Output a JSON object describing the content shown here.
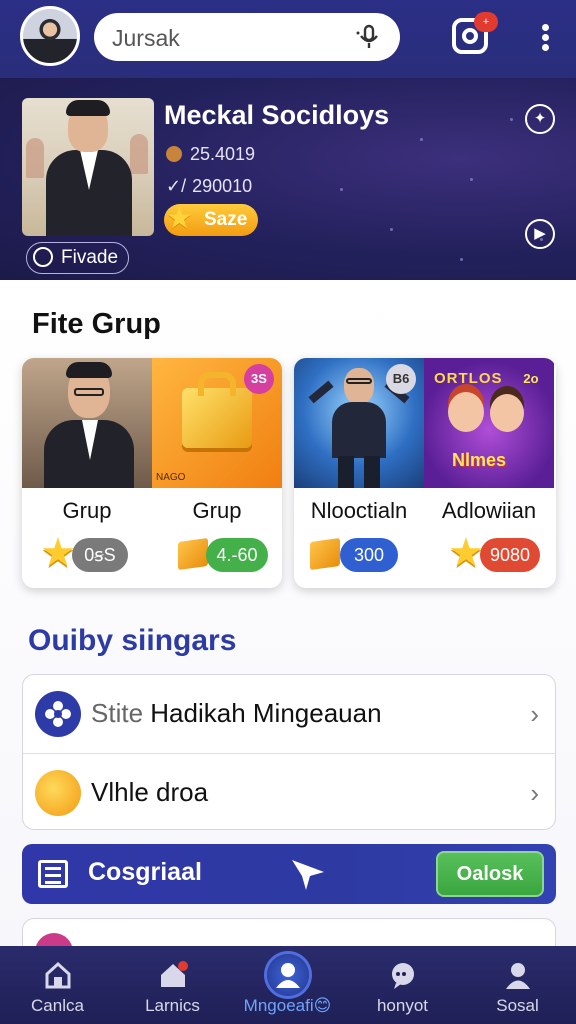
{
  "topbar": {
    "search_value": "Jursak",
    "notification_badge": "+"
  },
  "profile": {
    "name": "Meckal Socidloys",
    "stat1": "25.4019",
    "stat2": "290010",
    "stat2_prefix": "✓/",
    "badge_label": "Saze",
    "chip_label": "Fivade"
  },
  "section1": {
    "title": "Fite Grup",
    "cards": [
      {
        "tiles": [
          {
            "label": "Grup",
            "value": "0ꞩS",
            "pill_color": "#7a7a7a",
            "icon": "star-icon"
          },
          {
            "label": "Grup",
            "value": "4.-60",
            "pill_color": "#44b04a",
            "icon": "box-icon",
            "badge": "3S"
          }
        ],
        "tile_badge_text": "NAGO"
      },
      {
        "tiles": [
          {
            "label": "Nlooctialn",
            "value": "300",
            "pill_color": "#2f5fd0",
            "icon": "box-icon",
            "badge": "B6"
          },
          {
            "label": "Adlowiian",
            "value": "9080",
            "pill_color": "#e04a32",
            "icon": "star-icon",
            "badge": "2o"
          }
        ],
        "poster_title": "ORTLOS",
        "poster_sub": "Nlmes"
      }
    ]
  },
  "section2": {
    "title": "Ouiby siingars",
    "rows": [
      {
        "muted": "Stite",
        "label": "Hadikah Mingeauan"
      },
      {
        "muted": "",
        "label": "Vlhle droa"
      }
    ]
  },
  "banner": {
    "label": "Cosgriaal",
    "button": "Oalosk"
  },
  "nav": {
    "items": [
      {
        "label": "Canlca"
      },
      {
        "label": "Larnics"
      },
      {
        "label": "Mngoeafi😊"
      },
      {
        "label": "honyot"
      },
      {
        "label": "Sosal"
      }
    ]
  },
  "colors": {
    "topbar": "#2b2f86",
    "hero": "#23215c",
    "accent_blue": "#2d3ba6",
    "green": "#44b04a"
  }
}
